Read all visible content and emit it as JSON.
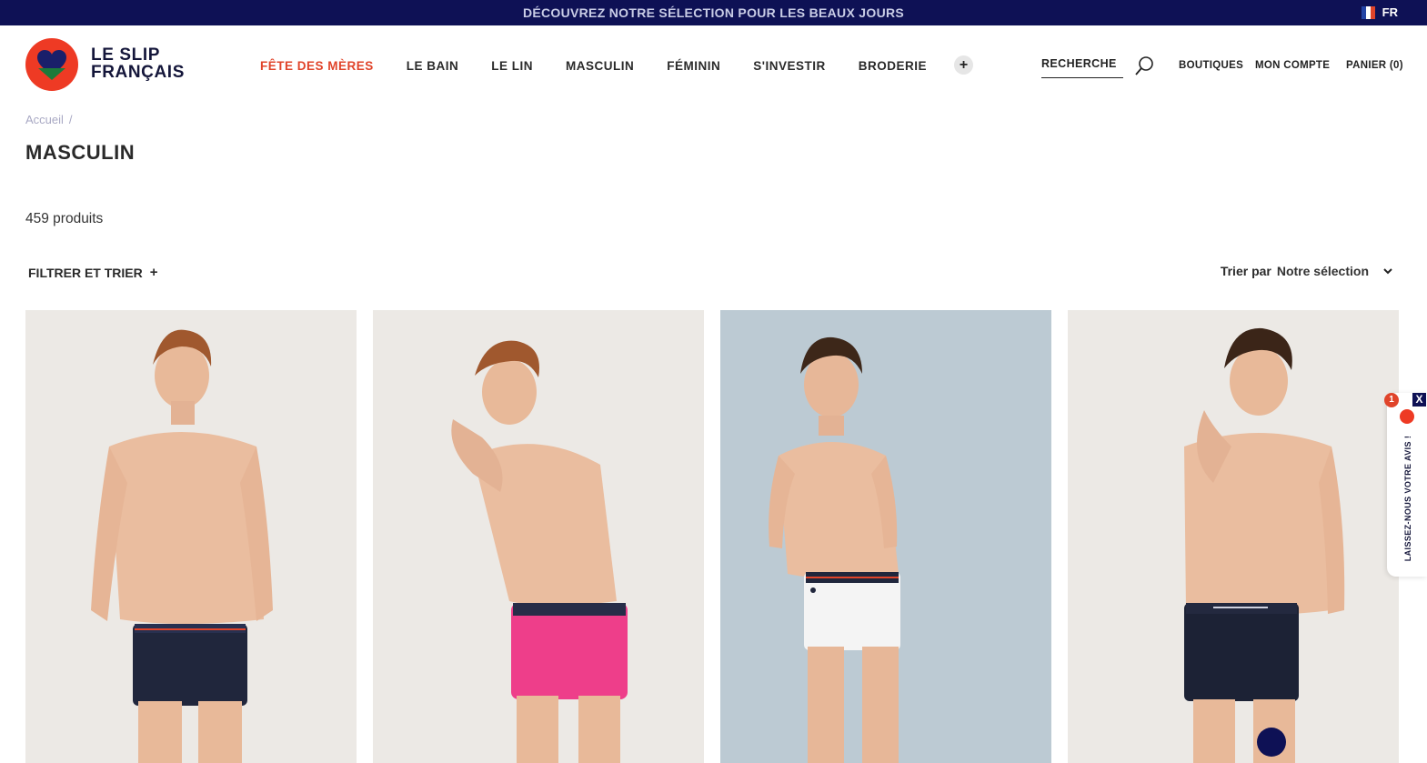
{
  "banner": {
    "message": "DÉCOUVREZ NOTRE SÉLECTION POUR LES BEAUX JOURS",
    "language": "FR"
  },
  "brand": {
    "line1": "LE SLIP",
    "line2": "FRANÇAIS",
    "accent_color": "#ee3a24",
    "navy": "#0e1155"
  },
  "nav": {
    "items": [
      {
        "label": "FÊTE DES MÈRES",
        "highlighted": true
      },
      {
        "label": "LE BAIN"
      },
      {
        "label": "LE LIN"
      },
      {
        "label": "MASCULIN"
      },
      {
        "label": "FÉMININ"
      },
      {
        "label": "S'INVESTIR"
      },
      {
        "label": "BRODERIE"
      }
    ],
    "more": "+"
  },
  "utility": {
    "search_label": "RECHERCHE",
    "stores": "BOUTIQUES",
    "account": "MON COMPTE",
    "cart": "PANIER (0)"
  },
  "breadcrumb": {
    "home": "Accueil",
    "separator": "/"
  },
  "page": {
    "title": "MASCULIN",
    "count": "459 produits"
  },
  "toolbar": {
    "filter_label": "FILTRER ET TRIER",
    "filter_plus": "+",
    "sort_prefix": "Trier par",
    "sort_value": "Notre sélection"
  },
  "products": [
    {
      "image": "model-navy-boxer",
      "trunk_color": "#20263c",
      "bg": "#ece9e5"
    },
    {
      "image": "model-pink-boxer",
      "trunk_color": "#ee3e8a",
      "bg": "#ece9e5"
    },
    {
      "image": "model-white-boxer",
      "trunk_color": "#f4f4f4",
      "bg": "#bccad3"
    },
    {
      "image": "model-navy-boxer-logo",
      "trunk_color": "#1c2235",
      "bg": "#ece9e5"
    }
  ],
  "review_widget": {
    "text": "LAISSEZ-NOUS VOTRE AVIS !",
    "badge": "1",
    "close": "X"
  }
}
